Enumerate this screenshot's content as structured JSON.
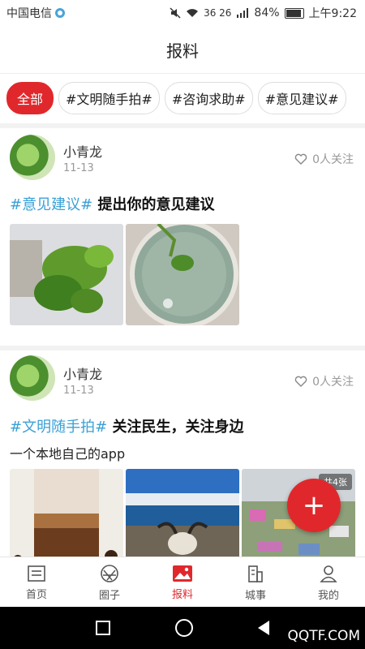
{
  "status": {
    "carrier": "中国电信",
    "battery": "84%",
    "time": "上午9:22",
    "network": "36 26",
    "battery_level": 0.84
  },
  "header": {
    "title": "报料"
  },
  "tags": [
    "全部",
    "#文明随手拍#",
    "#咨询求助#",
    "#意见建议#"
  ],
  "posts": [
    {
      "user": "小青龙",
      "date": "11-13",
      "follow": "0人关注",
      "topic": "#意见建议#",
      "title": "提出你的意见建议",
      "desc": ""
    },
    {
      "user": "小青龙",
      "date": "11-13",
      "follow": "0人关注",
      "topic": "#文明随手拍#",
      "title": "关注民生，关注身边",
      "desc": "一个本地自己的app",
      "image_count": "共4张"
    }
  ],
  "fab": {
    "label": "+"
  },
  "tabbar": {
    "items": [
      "首页",
      "圈子",
      "报料",
      "城事",
      "我的"
    ],
    "active": 2
  },
  "watermark": "QQTF.COM",
  "colors": {
    "accent": "#e0282c",
    "topic": "#3aa0d6"
  }
}
